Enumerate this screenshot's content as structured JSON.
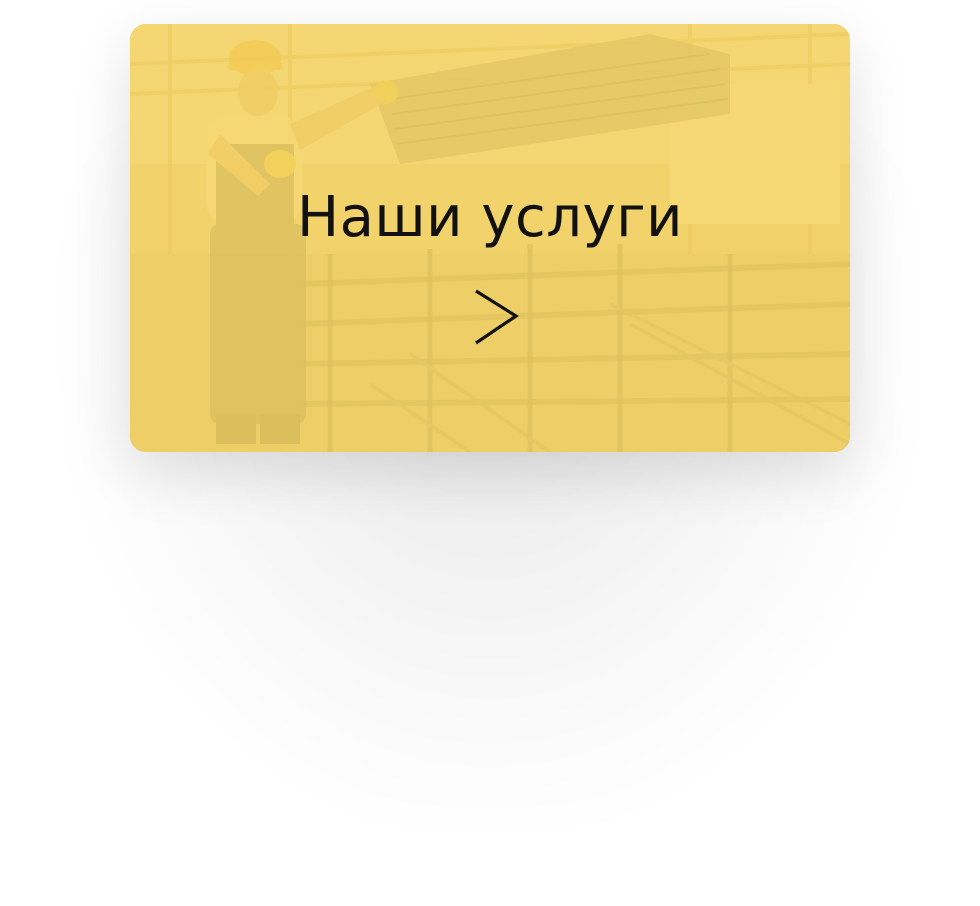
{
  "card": {
    "title": "Наши услуги",
    "overlay_color": "#f7d45f",
    "arrow_icon": "chevron-right-icon"
  },
  "photo": {
    "subject": "warehouse-worker-with-metal-profiles"
  }
}
